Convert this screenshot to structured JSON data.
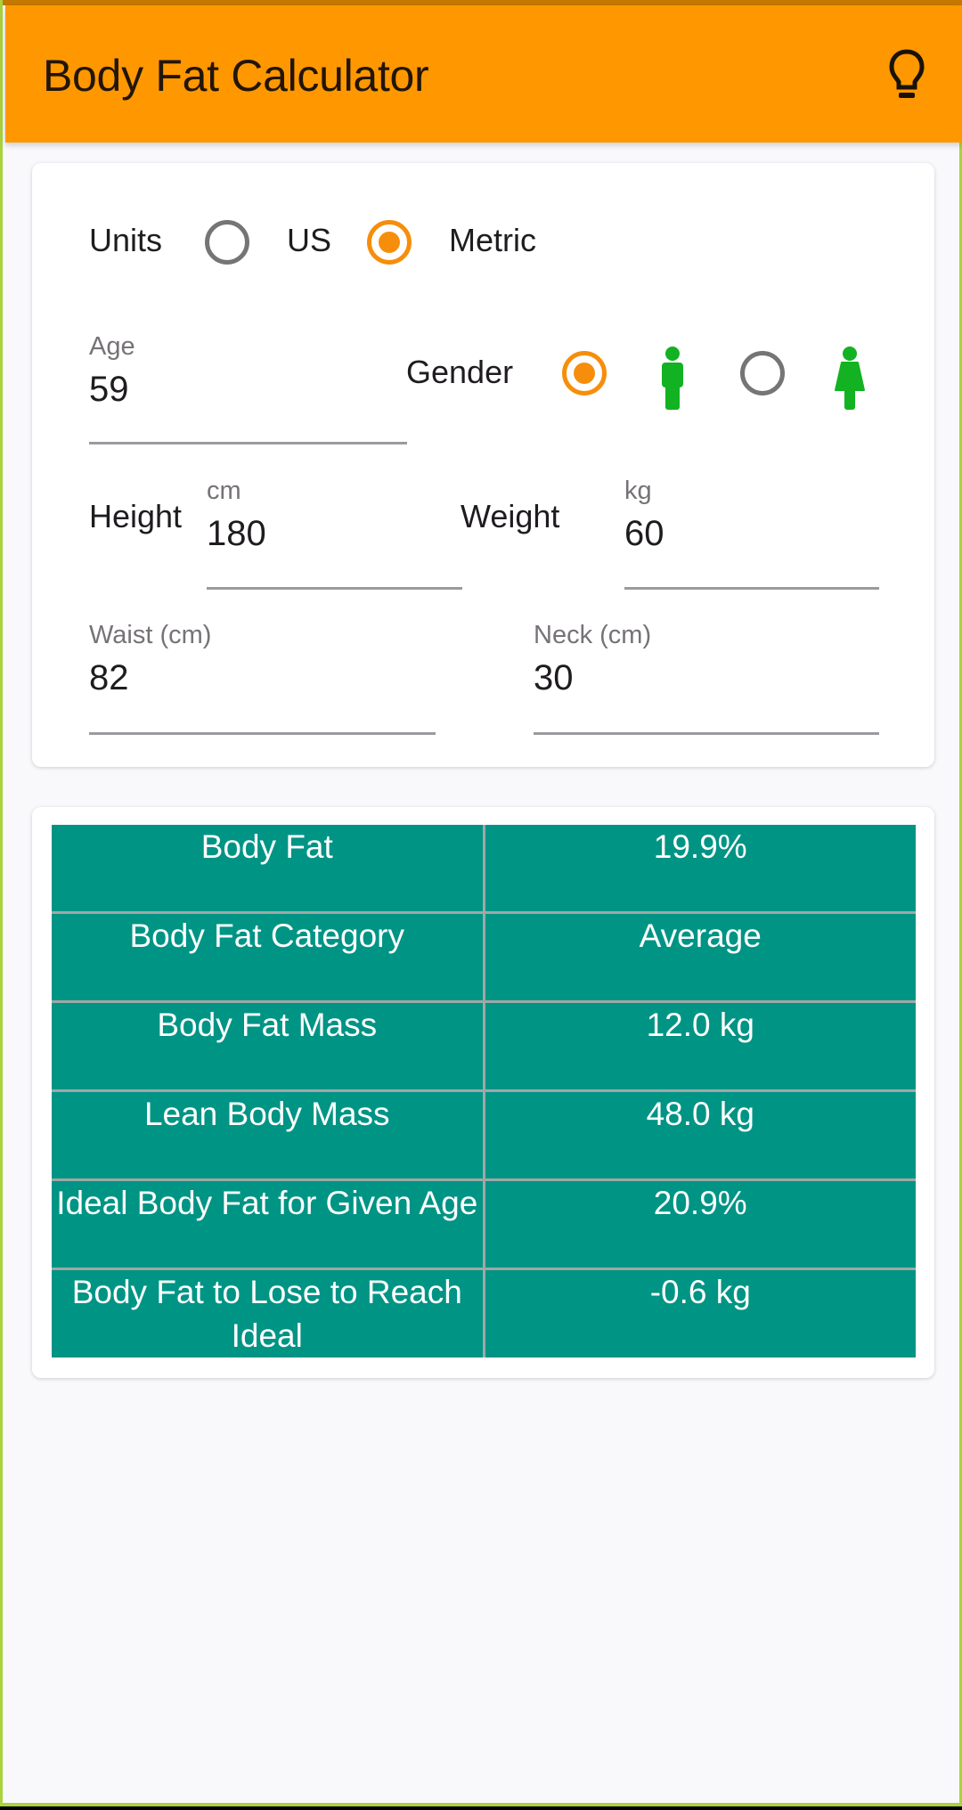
{
  "app": {
    "title": "Body Fat Calculator",
    "action_icon": "lightbulb-icon"
  },
  "colors": {
    "app_bar": "#ff9800",
    "radio_selected": "#f68e0c",
    "radio_unselected": "#757575",
    "gender_icon": "#12b222",
    "table_bg": "#009485",
    "frame_border": "#a9d23c"
  },
  "inputs": {
    "units": {
      "label": "Units",
      "options": [
        {
          "label": "US",
          "selected": false
        },
        {
          "label": "Metric",
          "selected": true
        }
      ]
    },
    "age": {
      "label": "Age",
      "value": "59"
    },
    "gender": {
      "label": "Gender",
      "options": [
        {
          "icon": "male-icon",
          "selected": true
        },
        {
          "icon": "female-icon",
          "selected": false
        }
      ]
    },
    "height": {
      "label": "Height",
      "unit": "cm",
      "value": "180"
    },
    "weight": {
      "label": "Weight",
      "unit": "kg",
      "value": "60"
    },
    "waist": {
      "label": "Waist (cm)",
      "value": "82"
    },
    "neck": {
      "label": "Neck (cm)",
      "value": "30"
    }
  },
  "results": [
    {
      "label": "Body Fat",
      "value": "19.9%"
    },
    {
      "label": "Body Fat Category",
      "value": "Average"
    },
    {
      "label": "Body Fat Mass",
      "value": "12.0 kg"
    },
    {
      "label": "Lean Body Mass",
      "value": "48.0 kg"
    },
    {
      "label": "Ideal Body Fat for Given Age",
      "value": "20.9%"
    },
    {
      "label": "Body Fat to Lose to Reach Ideal",
      "value": "-0.6 kg"
    }
  ]
}
